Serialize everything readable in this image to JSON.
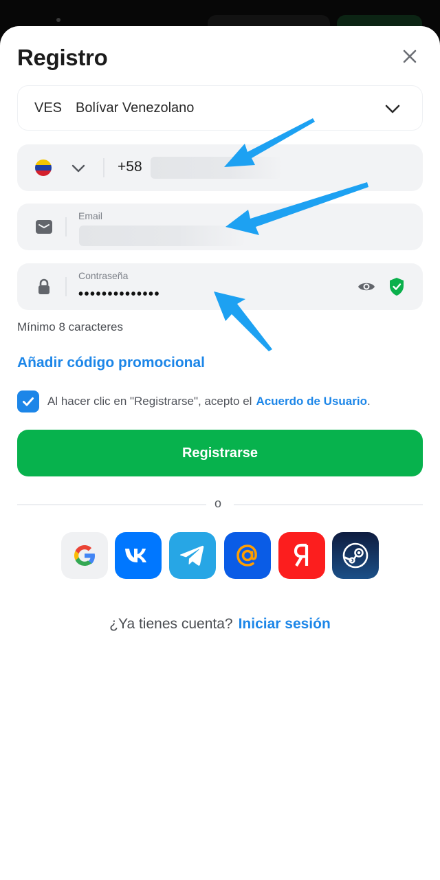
{
  "dialog": {
    "title": "Registro",
    "close_icon": "close-icon"
  },
  "currency": {
    "code": "VES",
    "name": "Bolívar Venezolano"
  },
  "phone": {
    "country_flag": "venezuela-flag-icon",
    "prefix": "+58"
  },
  "email": {
    "label": "Email"
  },
  "password": {
    "label": "Contraseña",
    "masked_value": "••••••••••••••",
    "hint": "Mínimo 8 caracteres"
  },
  "promo": {
    "label": "Añadir código promocional"
  },
  "agreement": {
    "checked": true,
    "text": "Al hacer clic en \"Registrarse\", acepto el",
    "link": "Acuerdo de Usuario",
    "end": "."
  },
  "register_button": {
    "label": "Registrarse"
  },
  "divider": {
    "label": "o"
  },
  "social": [
    {
      "name": "google-icon",
      "label": "G"
    },
    {
      "name": "vk-icon",
      "label": "VK"
    },
    {
      "name": "telegram-icon",
      "label": ""
    },
    {
      "name": "mail-ru-icon",
      "label": "@"
    },
    {
      "name": "yandex-icon",
      "label": "Я"
    },
    {
      "name": "steam-icon",
      "label": ""
    }
  ],
  "login": {
    "prompt": "¿Ya tienes cuenta?",
    "link": "Iniciar sesión"
  },
  "colors": {
    "accent": "#1c86e8",
    "primary_button": "#07b24d",
    "annotation_arrow": "#1da1f2"
  }
}
